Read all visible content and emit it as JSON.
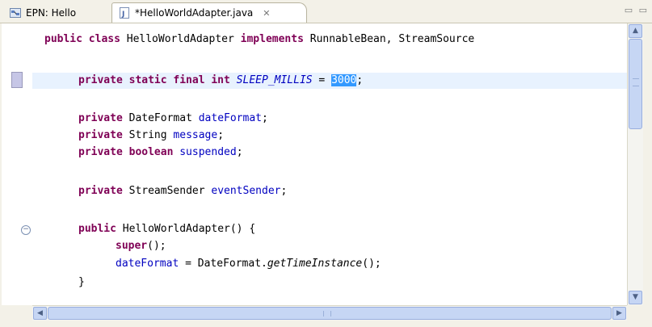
{
  "tabs": [
    {
      "label": "EPN: Hello",
      "icon": "epn-diagram-icon",
      "active": false
    },
    {
      "label": "*HelloWorldAdapter.java",
      "icon": "java-file-icon",
      "active": true,
      "close": "✕"
    }
  ],
  "window_controls": {
    "minmax": "▭ ▭"
  },
  "code": {
    "l1": {
      "kw1": "public class",
      "t1": " HelloWorldAdapter ",
      "kw2": "implements",
      "t2": " RunnableBean, StreamSource"
    },
    "l2": {
      "kw": "private static final int",
      "sp": " ",
      "const": "SLEEP_MILLIS",
      "eq": " = ",
      "sel": "3000",
      "end": ";"
    },
    "l3": {
      "kw": "private",
      "t": " DateFormat ",
      "fld": "dateFormat",
      "end": ";"
    },
    "l4": {
      "kw": "private",
      "t": " String ",
      "fld": "message",
      "end": ";"
    },
    "l5": {
      "kw": "private boolean",
      "sp": " ",
      "fld": "suspended",
      "end": ";"
    },
    "l6": {
      "kw": "private",
      "t": " StreamSender ",
      "fld": "eventSender",
      "end": ";"
    },
    "l7": {
      "kw": "public",
      "t": " HelloWorldAdapter() {"
    },
    "l8": {
      "kw": "super",
      "t": "();"
    },
    "l9": {
      "fld": "dateFormat",
      "t": " = DateFormat.",
      "method": "getTimeInstance",
      "end": "();"
    },
    "l10": {
      "t": "}"
    }
  },
  "fold_glyph": "−",
  "scroll": {
    "up": "▲",
    "down": "▼",
    "left": "◀",
    "right": "▶"
  }
}
